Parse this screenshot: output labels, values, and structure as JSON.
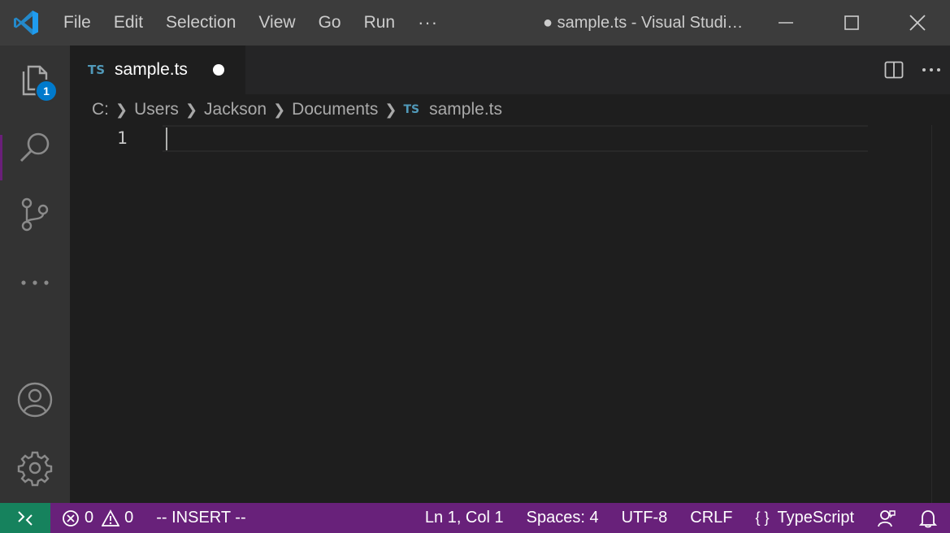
{
  "window": {
    "title": "● sample.ts - Visual Studi…"
  },
  "menu": {
    "items": [
      "File",
      "Edit",
      "Selection",
      "View",
      "Go",
      "Run"
    ],
    "more": "···"
  },
  "activity_bar": {
    "explorer_badge": "1"
  },
  "tabs": [
    {
      "icon_text": "TS",
      "label": "sample.ts",
      "dirty": true
    }
  ],
  "breadcrumb": {
    "parts": [
      "C:",
      "Users",
      "Jackson",
      "Documents"
    ],
    "file_icon_text": "TS",
    "file": "sample.ts"
  },
  "editor": {
    "line_numbers": [
      "1"
    ]
  },
  "status": {
    "errors": "0",
    "warnings": "0",
    "mode": "-- INSERT --",
    "position": "Ln 1, Col 1",
    "spaces": "Spaces: 4",
    "encoding": "UTF-8",
    "eol": "CRLF",
    "language_icon": "{ }",
    "language": "TypeScript"
  },
  "colors": {
    "titlebar": "#3c3c3c",
    "activitybar": "#333333",
    "editor": "#1e1e1e",
    "statusbar": "#68217a",
    "remote": "#16825d",
    "badge": "#007acc",
    "ts_icon": "#519aba"
  }
}
